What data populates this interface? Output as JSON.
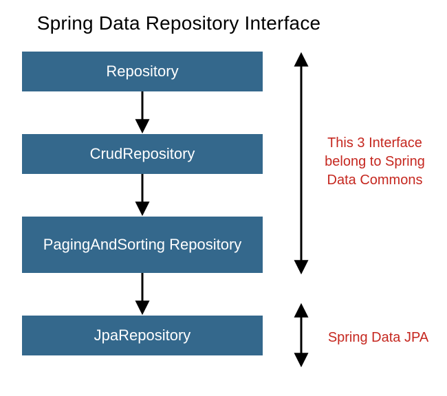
{
  "title": "Spring Data Repository Interface",
  "boxes": {
    "repository": "Repository",
    "crud": "CrudRepository",
    "paging": "PagingAndSorting Repository",
    "jpa": "JpaRepository"
  },
  "annotations": {
    "commons": "This 3 Interface belong to Spring Data Commons",
    "jpa": "Spring Data JPA"
  },
  "colors": {
    "box_fill": "#34688c",
    "box_text": "#ffffff",
    "annotation_text": "#c5271f",
    "arrow": "#000000"
  }
}
